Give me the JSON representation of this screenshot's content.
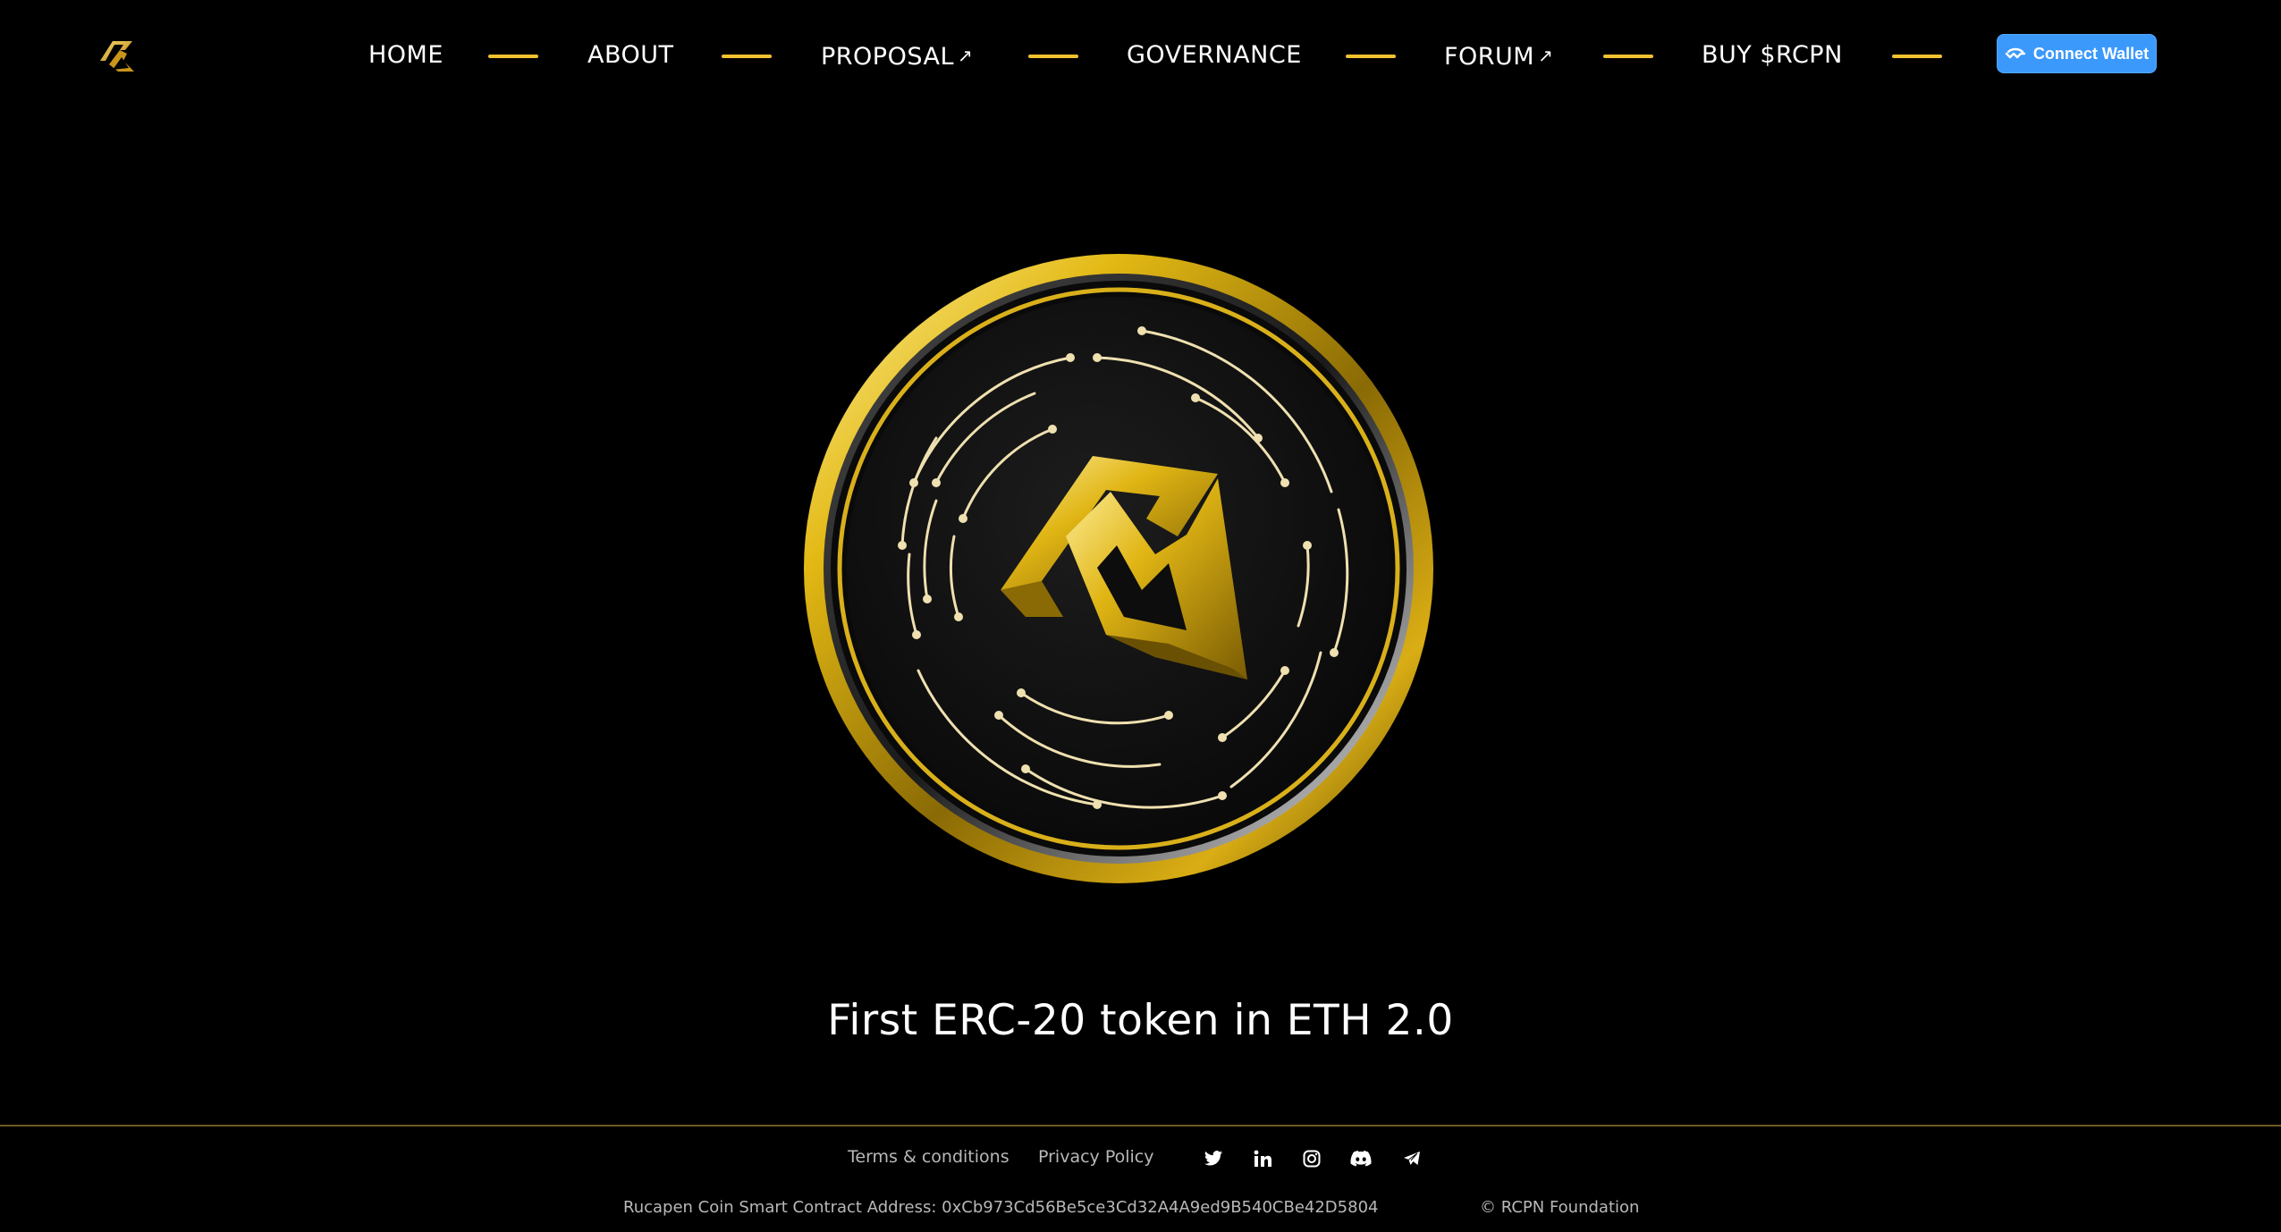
{
  "header": {
    "logo_icon": "rcpn-logo-icon",
    "nav": [
      {
        "label": "HOME",
        "external": false
      },
      {
        "label": "ABOUT",
        "external": false
      },
      {
        "label": "PROPOSAL",
        "external": true
      },
      {
        "label": "GOVERNANCE",
        "external": false
      },
      {
        "label": "FORUM",
        "external": true
      },
      {
        "label": "BUY $RCPN",
        "external": false
      }
    ],
    "external_icon": "↗",
    "connect_wallet_label": "Connect Wallet"
  },
  "hero": {
    "coin_icon": "rcpn-coin-icon",
    "tagline": "First ERC-20 token in ETH 2.0"
  },
  "footer": {
    "links": {
      "terms": "Terms & conditions",
      "privacy": "Privacy Policy"
    },
    "socials": [
      "twitter-icon",
      "linkedin-icon",
      "instagram-icon",
      "discord-icon",
      "telegram-icon"
    ],
    "contract_address": "Rucapen Coin Smart Contract Address: 0xCb973Cd56Be5ce3Cd32A4A9ed9B540CBe42D5804",
    "copyright": "© RCPN Foundation"
  },
  "colors": {
    "background": "#000000",
    "accent_gold": "#f2c12e",
    "wallet_blue": "#3b99fc",
    "footer_text": "#b8b8b8",
    "footer_rule": "#6e5a23"
  }
}
